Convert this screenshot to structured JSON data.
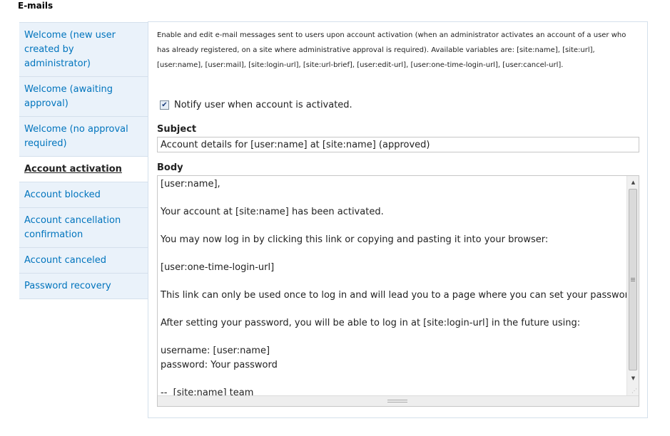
{
  "section": {
    "title": "E-mails"
  },
  "sidebar": {
    "items": [
      {
        "label": "Welcome (new user created by administrator)",
        "active": false
      },
      {
        "label": "Welcome (awaiting approval)",
        "active": false
      },
      {
        "label": "Welcome (no approval required)",
        "active": false
      },
      {
        "label": "Account activation",
        "active": true
      },
      {
        "label": "Account blocked",
        "active": false
      },
      {
        "label": "Account cancellation confirmation",
        "active": false
      },
      {
        "label": "Account canceled",
        "active": false
      },
      {
        "label": "Password recovery",
        "active": false
      }
    ]
  },
  "panel": {
    "description": "Enable and edit e-mail messages sent to users upon account activation (when an administrator activates an account of a user who has already registered, on a site where administrative approval is required). Available variables are: [site:name], [site:url], [user:name], [user:mail], [site:login-url], [site:url-brief], [user:edit-url], [user:one-time-login-url], [user:cancel-url].",
    "notify_checkbox": {
      "label": "Notify user when account is activated.",
      "checked": true
    },
    "subject": {
      "label": "Subject",
      "value": "Account details for [user:name] at [site:name] (approved)"
    },
    "body": {
      "label": "Body",
      "value": "[user:name],\n\nYour account at [site:name] has been activated.\n\nYou may now log in by clicking this link or copying and pasting it into your browser:\n\n[user:one-time-login-url]\n\nThis link can only be used once to log in and will lead you to a page where you can set your password.\n\nAfter setting your password, you will be able to log in at [site:login-url] in the future using:\n\nusername: [user:name]\npassword: Your password\n\n--  [site:name] team"
    }
  },
  "icons": {
    "checkbox_check": "checkmark-icon",
    "scroll_up": "arrow-up-icon",
    "scroll_down": "arrow-down-icon"
  },
  "colors": {
    "link": "#0074bd",
    "sidebar_bg": "#eaf2fa",
    "border": "#d4e0ec"
  }
}
